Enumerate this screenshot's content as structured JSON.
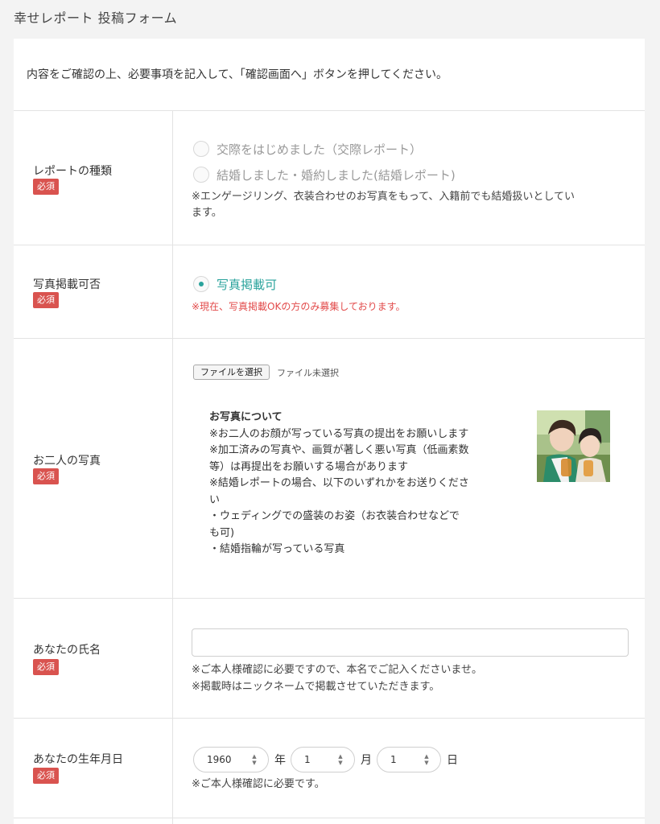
{
  "page": {
    "title": "幸せレポート 投稿フォーム"
  },
  "intro": "内容をご確認の上、必要事項を記入して、「確認画面へ」ボタンを押してください。",
  "required_label": "必須",
  "report_type": {
    "label": "レポートの種類",
    "options": [
      {
        "label": "交際をはじめました（交際レポート）",
        "checked": false
      },
      {
        "label": "結婚しました・婚約しました(結婚レポート)",
        "checked": false
      }
    ],
    "note_line1": "※エンゲージリング、衣装合わせのお写真をもって、入籍前でも結婚扱いとしてい",
    "note_line2": "ます。"
  },
  "photo_permission": {
    "label": "写真掲載可否",
    "option": {
      "label": "写真掲載可",
      "checked": true
    },
    "note": "※現在、写真掲載OKの方のみ募集しております。"
  },
  "couple_photo": {
    "label": "お二人の写真",
    "file_button": "ファイルを選択",
    "file_status": "ファイル未選択",
    "info": {
      "heading": "お写真について",
      "lines": [
        "※お二人のお顔が写っている写真の提出をお願いします",
        "※加工済みの写真や、画質が著しく悪い写真（低画素数",
        "等）は再提出をお願いする場合があります",
        "※結婚レポートの場合、以下のいずれかをお送りくださ",
        "い",
        "・ウェディングでの盛装のお姿（お衣装合わせなどで",
        "も可)",
        "・結婚指輪が写っている写真"
      ]
    }
  },
  "name": {
    "label": "あなたの氏名",
    "value": "",
    "note_line1": "※ご本人様確認に必要ですので、本名でご記入くださいませ。",
    "note_line2": "※掲載時はニックネームで掲載させていただきます。"
  },
  "birthdate": {
    "label": "あなたの生年月日",
    "year": "1960",
    "year_unit": "年",
    "month": "1",
    "month_unit": "月",
    "day": "1",
    "day_unit": "日",
    "note": "※ご本人様確認に必要です。"
  },
  "colors": {
    "accent": "#2aa39c",
    "required": "#d9534f",
    "warning": "#e24a4a"
  }
}
